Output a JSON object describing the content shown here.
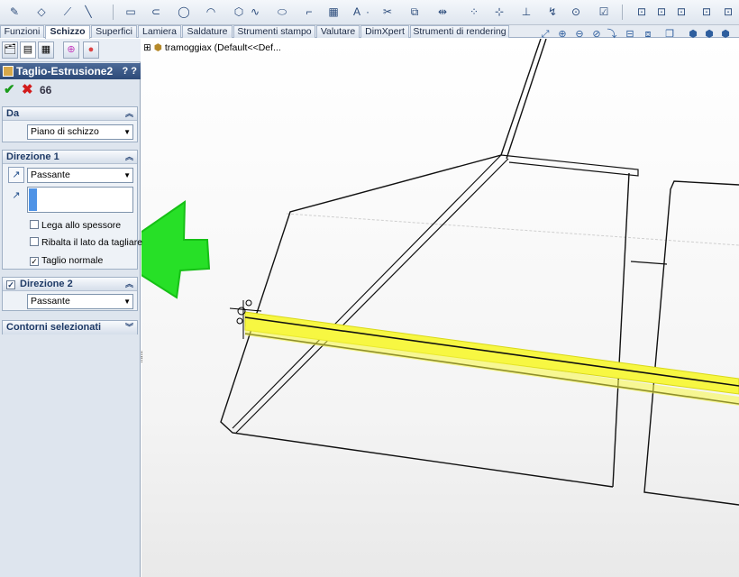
{
  "tabs": [
    "Funzioni",
    "Schizzo",
    "Superfici",
    "Lamiera",
    "Saldature",
    "Strumenti stampo",
    "Valutare",
    "DimXpert",
    "Strumenti di rendering"
  ],
  "active_tab": "Schizzo",
  "feature": {
    "title": "Taglio-Estrusione2",
    "help": "? ?"
  },
  "actions": {
    "ok": "✔",
    "cancel": "✖",
    "preview": "66"
  },
  "da": {
    "title": "Da",
    "value": "Piano di schizzo"
  },
  "direzione1": {
    "title": "Direzione 1",
    "type": "Passante",
    "checkboxes": [
      {
        "label": "Lega allo spessore",
        "checked": false
      },
      {
        "label": "Ribalta il lato da tagliare",
        "checked": false
      },
      {
        "label": "Taglio normale",
        "checked": true
      }
    ]
  },
  "direzione2": {
    "title": "Direzione 2",
    "checked": true,
    "type": "Passante"
  },
  "contorni": {
    "title": "Contorni selezionati"
  },
  "tree": {
    "label": "tramoggiax  (Default<<Def..."
  },
  "colors": {
    "header": "#2d4a78",
    "highlight": "#f2f21a",
    "arrow": "#22e022"
  }
}
